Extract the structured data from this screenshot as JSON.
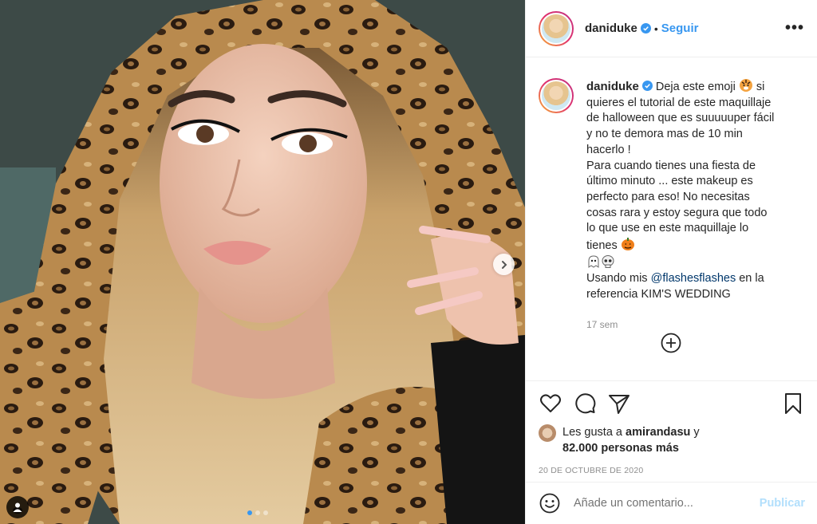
{
  "post": {
    "username": "daniduke",
    "follow_label": "Seguir",
    "bullet": "•",
    "more_label": "•••"
  },
  "caption": {
    "username": "daniduke",
    "part1": "Deja este emoji ",
    "part2": " si quieres el tutorial de este maquillaje de halloween que es suuuuuper fácil y no te demora mas de 10 min hacerlo !",
    "part3": "Para cuando tienes una fiesta de último minuto ... este makeup es perfecto para eso! No necesitas cosas rara y estoy segura que todo lo que use en este maquillaje lo tienes ",
    "part4_prefix": "Usando mis ",
    "mention": "@flashesflashes",
    "part4_suffix": " en la referencia KIM'S WEDDING",
    "time": "17 sem"
  },
  "likes": {
    "prefix": "Les gusta a ",
    "user": "amirandasu",
    "conj": " y",
    "others": "82.000 personas más"
  },
  "date": "20 DE OCTUBRE DE 2020",
  "comment_box": {
    "placeholder": "Añade un comentario...",
    "publish_label": "Publicar"
  },
  "carousel": {
    "total": 3,
    "active": 1
  },
  "colors": {
    "accent": "#3897f0",
    "publish_disabled": "#b2dffc",
    "mention": "#00376b"
  },
  "icons": [
    "heart-icon",
    "comment-icon",
    "share-icon",
    "bookmark-icon",
    "plus-circle-icon",
    "smiley-icon",
    "user-tag-icon",
    "chevron-right-icon",
    "verified-badge-icon"
  ]
}
